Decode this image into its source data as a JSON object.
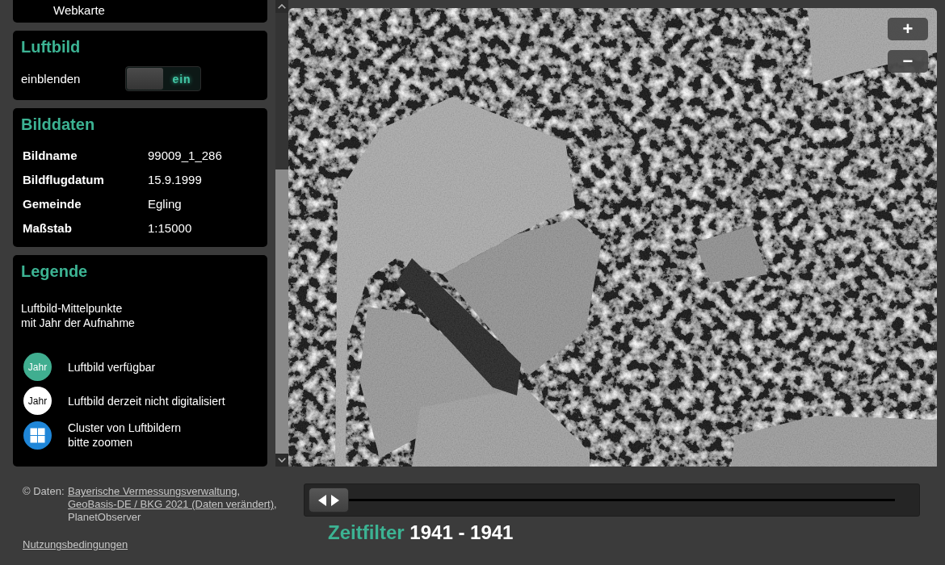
{
  "layer_panel": {
    "option": "Webkarte"
  },
  "aerial_panel": {
    "title": "Luftbild",
    "toggle": {
      "label": "einblenden",
      "state_text": "ein",
      "on": true
    }
  },
  "image_data": {
    "title": "Bilddaten",
    "rows": [
      {
        "label": "Bildname",
        "value": "99009_1_286"
      },
      {
        "label": "Bildflugdatum",
        "value": "15.9.1999"
      },
      {
        "label": "Gemeinde",
        "value": "Egling"
      },
      {
        "label": "Maßstab",
        "value": "1:15000"
      }
    ]
  },
  "legend": {
    "title": "Legende",
    "intro": "Luftbild-Mittelpunkte\nmit Jahr der Aufnahme",
    "items": [
      {
        "kind": "marker",
        "badge": "Jahr",
        "color": "#40ae90",
        "label": "Luftbild verfügbar"
      },
      {
        "kind": "marker",
        "badge": "Jahr",
        "color": "#ffffff",
        "label": "Luftbild derzeit nicht digitalisiert"
      },
      {
        "kind": "cluster",
        "color": "#1f86d8",
        "label": "Cluster von Luftbildern\nbitte zoomen"
      }
    ]
  },
  "map": {
    "zoom_buttons": [
      "+",
      "−"
    ]
  },
  "attribution": {
    "label": "© Daten:",
    "parts": [
      {
        "kind": "link",
        "text": "Bayerische Vermessungsverwaltung"
      },
      {
        "kind": "text",
        "text": ", "
      },
      {
        "kind": "link",
        "text": "GeoBasis-DE / BKG 2021 (Daten verändert)"
      },
      {
        "kind": "text",
        "text": ", PlanetObserver"
      }
    ]
  },
  "terms_link": "Nutzungsbedingungen",
  "time_filter": {
    "level": 0,
    "label": "Zeitfilter",
    "range": "1941 - 1941"
  }
}
